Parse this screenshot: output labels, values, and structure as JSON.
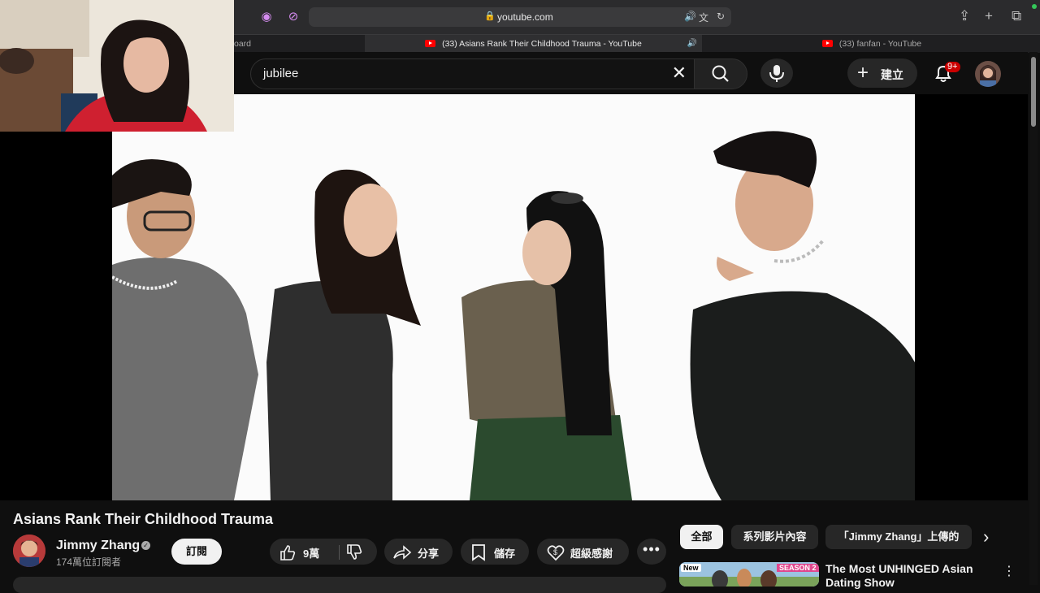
{
  "browser": {
    "url": "youtube.com",
    "tabs": [
      {
        "label": "oard",
        "active": false
      },
      {
        "label": "(33) Asians Rank Their Childhood Trauma - YouTube",
        "active": true
      },
      {
        "label": "(33) fanfan - YouTube",
        "active": false
      }
    ]
  },
  "header": {
    "search_value": "jubilee",
    "create_label": "建立",
    "notification_badge": "9+"
  },
  "video": {
    "title": "Asians Rank Their Childhood Trauma",
    "channel_name": "Jimmy Zhang",
    "subscribers": "174萬位訂閱者",
    "subscribe_label": "訂閱",
    "like_count": "9萬",
    "share_label": "分享",
    "save_label": "儲存",
    "thanks_label": "超級感謝",
    "more_label": "•••"
  },
  "chips": [
    {
      "label": "全部",
      "selected": true
    },
    {
      "label": "系列影片內容",
      "selected": false
    },
    {
      "label": "「Jimmy Zhang」上傳的",
      "selected": false
    }
  ],
  "recommendation": {
    "title": "The Most UNHINGED Asian Dating Show",
    "badge": "New",
    "season": "SEASON 2"
  },
  "colors": {
    "youtube_red": "#ff0000",
    "background": "#0f0f0f",
    "safari_toolbar": "#2b2b2d"
  }
}
